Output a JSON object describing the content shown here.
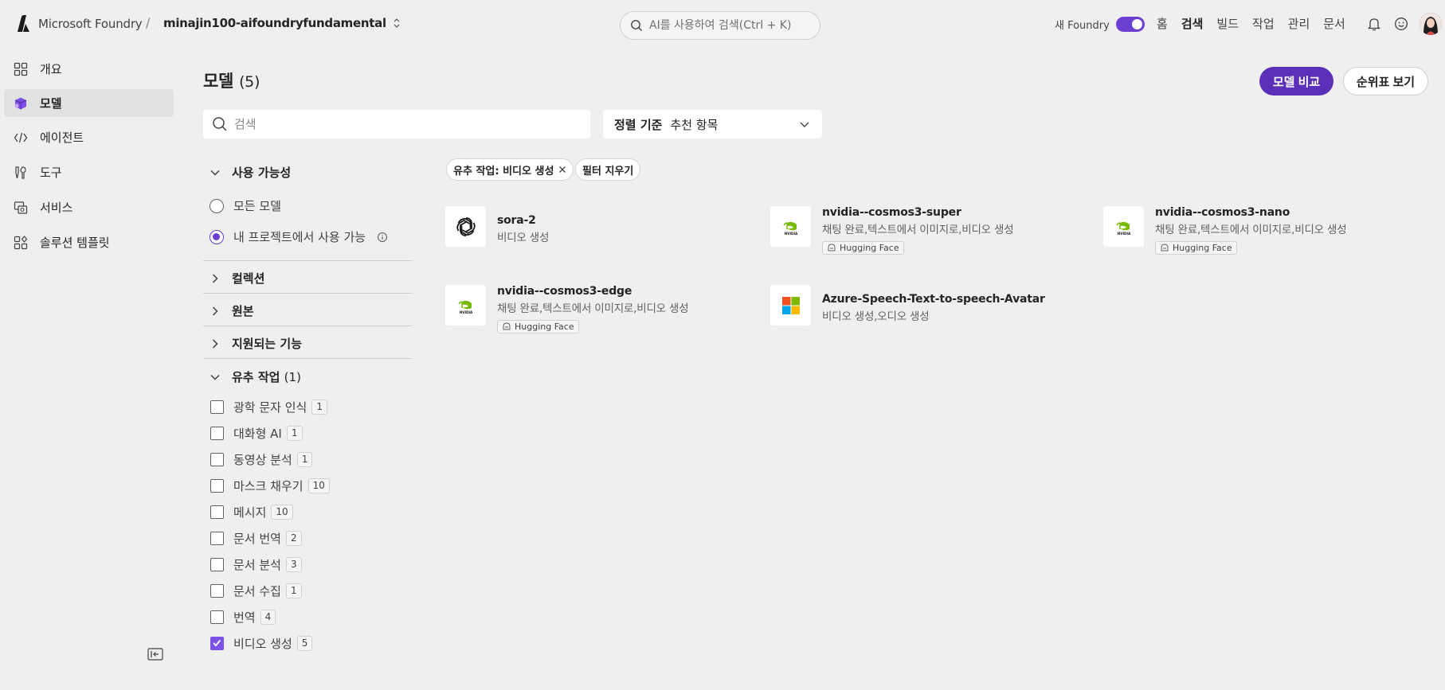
{
  "header": {
    "brand": "Microsoft Foundry",
    "separator": "/",
    "project": "minajin100-aifoundryfundamental",
    "search_placeholder": "AI를 사용하여 검색(Ctrl + K)",
    "new_foundry_label": "새 Foundry",
    "new_foundry_on": true,
    "nav": [
      "홈",
      "검색",
      "빌드",
      "작업",
      "관리",
      "문서"
    ],
    "nav_active": "검색"
  },
  "sidebar": {
    "items": [
      {
        "label": "개요",
        "icon": "grid-icon"
      },
      {
        "label": "모델",
        "icon": "cube-icon",
        "active": true
      },
      {
        "label": "에이전트",
        "icon": "code-icon"
      },
      {
        "label": "도구",
        "icon": "tools-icon"
      },
      {
        "label": "서비스",
        "icon": "services-icon"
      },
      {
        "label": "솔루션 템플릿",
        "icon": "template-icon"
      }
    ]
  },
  "main": {
    "title": "모델",
    "count": "(5)",
    "compare_button": "모델 비교",
    "leaderboard_button": "순위표 보기",
    "search_placeholder": "검색",
    "sort_label": "정렬 기준",
    "sort_value": "추천 항목"
  },
  "filters": {
    "availability": {
      "title": "사용 가능성",
      "options": [
        {
          "label": "모든 모델",
          "checked": false
        },
        {
          "label": "내 프로젝트에서 사용 가능",
          "checked": true
        }
      ]
    },
    "collapsed": [
      "컬렉션",
      "원본",
      "지원되는 기능"
    ],
    "inference": {
      "title": "유추 작업",
      "count": "(1)",
      "options": [
        {
          "label": "광학 문자 인식",
          "count": "1",
          "checked": false
        },
        {
          "label": "대화형 AI",
          "count": "1",
          "checked": false
        },
        {
          "label": "동영상 분석",
          "count": "1",
          "checked": false
        },
        {
          "label": "마스크 채우기",
          "count": "10",
          "checked": false
        },
        {
          "label": "메시지",
          "count": "10",
          "checked": false
        },
        {
          "label": "문서 번역",
          "count": "2",
          "checked": false
        },
        {
          "label": "문서 분석",
          "count": "3",
          "checked": false
        },
        {
          "label": "문서 수집",
          "count": "1",
          "checked": false
        },
        {
          "label": "번역",
          "count": "4",
          "checked": false
        },
        {
          "label": "비디오 생성",
          "count": "5",
          "checked": true
        }
      ]
    }
  },
  "active_filters": {
    "chip": "유추 작업: 비디오 생성",
    "clear": "필터 지우기"
  },
  "models": [
    {
      "name": "sora-2",
      "desc": "비디오 생성",
      "tag": "",
      "icon": "openai-icon"
    },
    {
      "name": "nvidia--cosmos3-super",
      "desc": "채팅 완료,텍스트에서 이미지로,비디오 생성",
      "tag": "Hugging Face",
      "icon": "nvidia-icon"
    },
    {
      "name": "nvidia--cosmos3-nano",
      "desc": "채팅 완료,텍스트에서 이미지로,비디오 생성",
      "tag": "Hugging Face",
      "icon": "nvidia-icon"
    },
    {
      "name": "nvidia--cosmos3-edge",
      "desc": "채팅 완료,텍스트에서 이미지로,비디오 생성",
      "tag": "Hugging Face",
      "icon": "nvidia-icon"
    },
    {
      "name": "Azure-Speech-Text-to-speech-Avatar",
      "desc": "비디오 생성,오디오 생성",
      "tag": "",
      "icon": "microsoft-icon"
    }
  ],
  "colors": {
    "accent": "#5b2fb8",
    "checkbox": "#7c52e6",
    "background": "#efefef"
  }
}
